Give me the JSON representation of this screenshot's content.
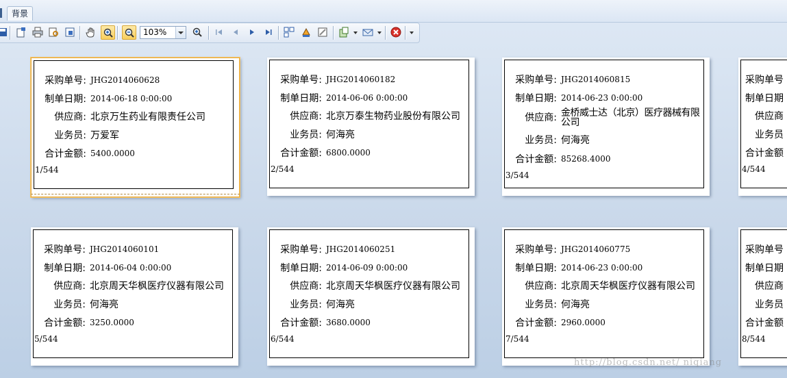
{
  "menubar": {
    "tab_label": "背景"
  },
  "toolbar": {
    "zoom_value": "103%",
    "buttons": [
      "save-icon",
      "page-setup-icon",
      "print-icon",
      "print-preview-icon",
      "export-icon",
      "hand-tool-icon",
      "zoom-in-tool-icon",
      "zoom-out-icon",
      "magnify-icon",
      "first-page-icon",
      "prev-page-icon",
      "next-page-icon",
      "last-page-icon",
      "multi-page-icon",
      "color-icon",
      "watermark-icon",
      "export-doc-icon",
      "email-icon",
      "close-icon",
      "overflow-icon"
    ]
  },
  "labels": {
    "po": "采购单号:",
    "date": "制单日期:",
    "supplier": "供应商:",
    "clerk": "业务员:",
    "total": "合计金额:"
  },
  "pages": [
    {
      "po": "JHG2014060628",
      "date": "2014-06-18 0:00:00",
      "supplier": "北京万生药业有限责任公司",
      "clerk": "万爱军",
      "total": "5400.0000",
      "num": "1/544"
    },
    {
      "po": "JHG2014060182",
      "date": "2014-06-06 0:00:00",
      "supplier": "北京万泰生物药业股份有限公司",
      "clerk": "何海亮",
      "total": "6800.0000",
      "num": "2/544"
    },
    {
      "po": "JHG2014060815",
      "date": "2014-06-23 0:00:00",
      "supplier": "金桥威士达（北京）医疗器械有限公司",
      "clerk": "何海亮",
      "total": "85268.4000",
      "num": "3/544"
    },
    {
      "num": "4/544"
    },
    {
      "po": "JHG2014060101",
      "date": "2014-06-04 0:00:00",
      "supplier": "北京周天华枫医疗仪器有限公司",
      "clerk": "何海亮",
      "total": "3250.0000",
      "num": "5/544"
    },
    {
      "po": "JHG2014060251",
      "date": "2014-06-09 0:00:00",
      "supplier": "北京周天华枫医疗仪器有限公司",
      "clerk": "何海亮",
      "total": "3680.0000",
      "num": "6/544"
    },
    {
      "po": "JHG2014060775",
      "date": "2014-06-23 0:00:00",
      "supplier": "北京周天华枫医疗仪器有限公司",
      "clerk": "何海亮",
      "total": "2960.0000",
      "num": "7/544"
    },
    {
      "num": "8/544"
    }
  ],
  "partial_labels": {
    "po": "采购单号",
    "date": "制单日期",
    "supplier": "供应商",
    "clerk": "业务员",
    "total": "合计金额"
  },
  "watermark": "http://blog.csdn.net/     niqiang"
}
